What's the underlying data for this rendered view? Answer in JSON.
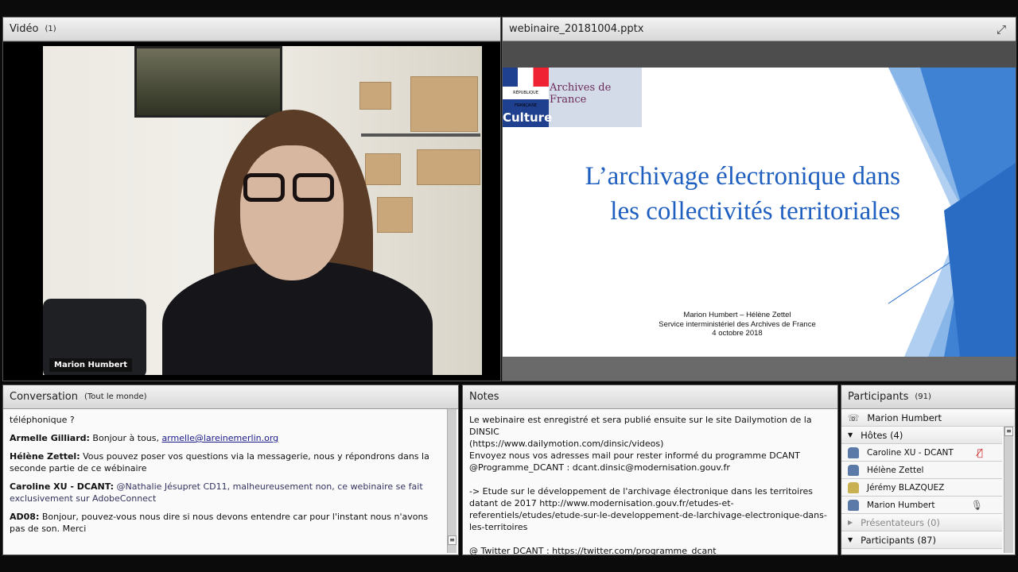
{
  "video": {
    "title": "Vidéo",
    "count": "(1)",
    "speaker": "Marion Humbert"
  },
  "presentation": {
    "filename": "webinaire_20181004.pptx",
    "slide": {
      "logo_text": "Archives de France",
      "logo_culture": "Culture",
      "logo_rf": "RÉPUBLIQUE FRANÇAISE",
      "title_line1": "L’archivage électronique dans",
      "title_line2": "les collectivités territoriales",
      "authors": "Marion Humbert – Hélène Zettel",
      "service": "Service interministériel des Archives de France",
      "date": "4 octobre 2018"
    }
  },
  "conversation": {
    "title": "Conversation",
    "scope": "(Tout le monde)",
    "messages": [
      {
        "author": "",
        "text": "téléphonique ?"
      },
      {
        "author": "Armelle Gilliard:",
        "text": " Bonjour à tous, ",
        "link": "armelle@lareinemerlin.org"
      },
      {
        "author": "Hélène Zettel:",
        "text": " Vous pouvez poser vos questions via la messagerie, nous y répondrons dans la seconde partie de ce wébinaire"
      },
      {
        "author": "Caroline XU - DCANT:",
        "text": " @Nathalie Jésupret CD11, malheureusement non, ce webinaire se fait exclusivement sur AdobeConnect"
      },
      {
        "author": "AD08:",
        "text": " Bonjour, pouvez-vous nous dire si nous devons entendre car pour l'instant nous n'avons pas de son. Merci"
      }
    ]
  },
  "notes": {
    "title": "Notes",
    "lines": [
      "Le webinaire est enregistré et sera publié ensuite sur le site Dailymotion de la DINSIC",
      "(https://www.dailymotion.com/dinsic/videos)",
      "Envoyez nous vos adresses mail pour rester informé du programme DCANT",
      "@Programme_DCANT : dcant.dinsic@modernisation.gouv.fr",
      "",
      "-> Etude sur le développement de l'archivage électronique dans les territoires datant de 2017 http://www.modernisation.gouv.fr/etudes-et-referentiels/etudes/etude-sur-le-developpement-de-larchivage-electronique-dans-les-territoires",
      "",
      "@ Twitter DCANT : https://twitter.com/programme_dcant"
    ]
  },
  "participants": {
    "title": "Participants",
    "count": "(91)",
    "phone_user": "Marion Humbert",
    "hosts_label": "Hôtes (4)",
    "hosts": [
      {
        "name": "Caroline XU - DCANT",
        "status": "mic-muted"
      },
      {
        "name": "Hélène Zettel",
        "status": ""
      },
      {
        "name": "Jérémy BLAZQUEZ",
        "status": ""
      },
      {
        "name": "Marion Humbert",
        "status": "speaking"
      }
    ],
    "presenters_label": "Présentateurs (0)",
    "participants_label": "Participants (87)"
  }
}
